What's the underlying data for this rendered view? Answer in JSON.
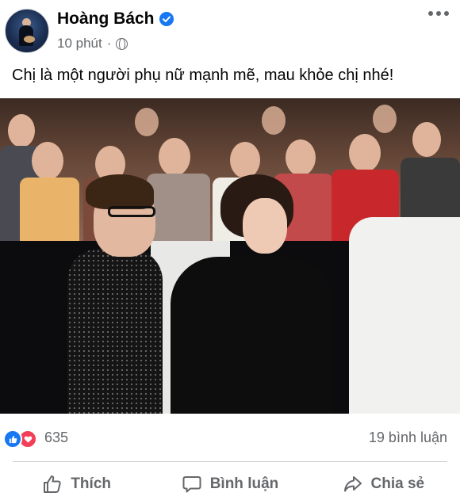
{
  "post": {
    "author": "Hoàng Bách",
    "time": "10 phút",
    "separator": "·",
    "privacy_icon": "globe-icon",
    "verified_icon": "verified-badge-icon",
    "text": "Chị là một người phụ nữ mạnh mẽ, mau khỏe chị nhé!"
  },
  "stats": {
    "reaction_icons": [
      "like-icon",
      "love-icon"
    ],
    "reactions_count": "635",
    "comments_count": "19 bình luận"
  },
  "actions": {
    "like": "Thích",
    "comment": "Bình luận",
    "share": "Chia sẻ"
  },
  "colors": {
    "facebook_blue": "#1877f2",
    "love_red": "#f33e58",
    "secondary_text": "#65676b"
  }
}
